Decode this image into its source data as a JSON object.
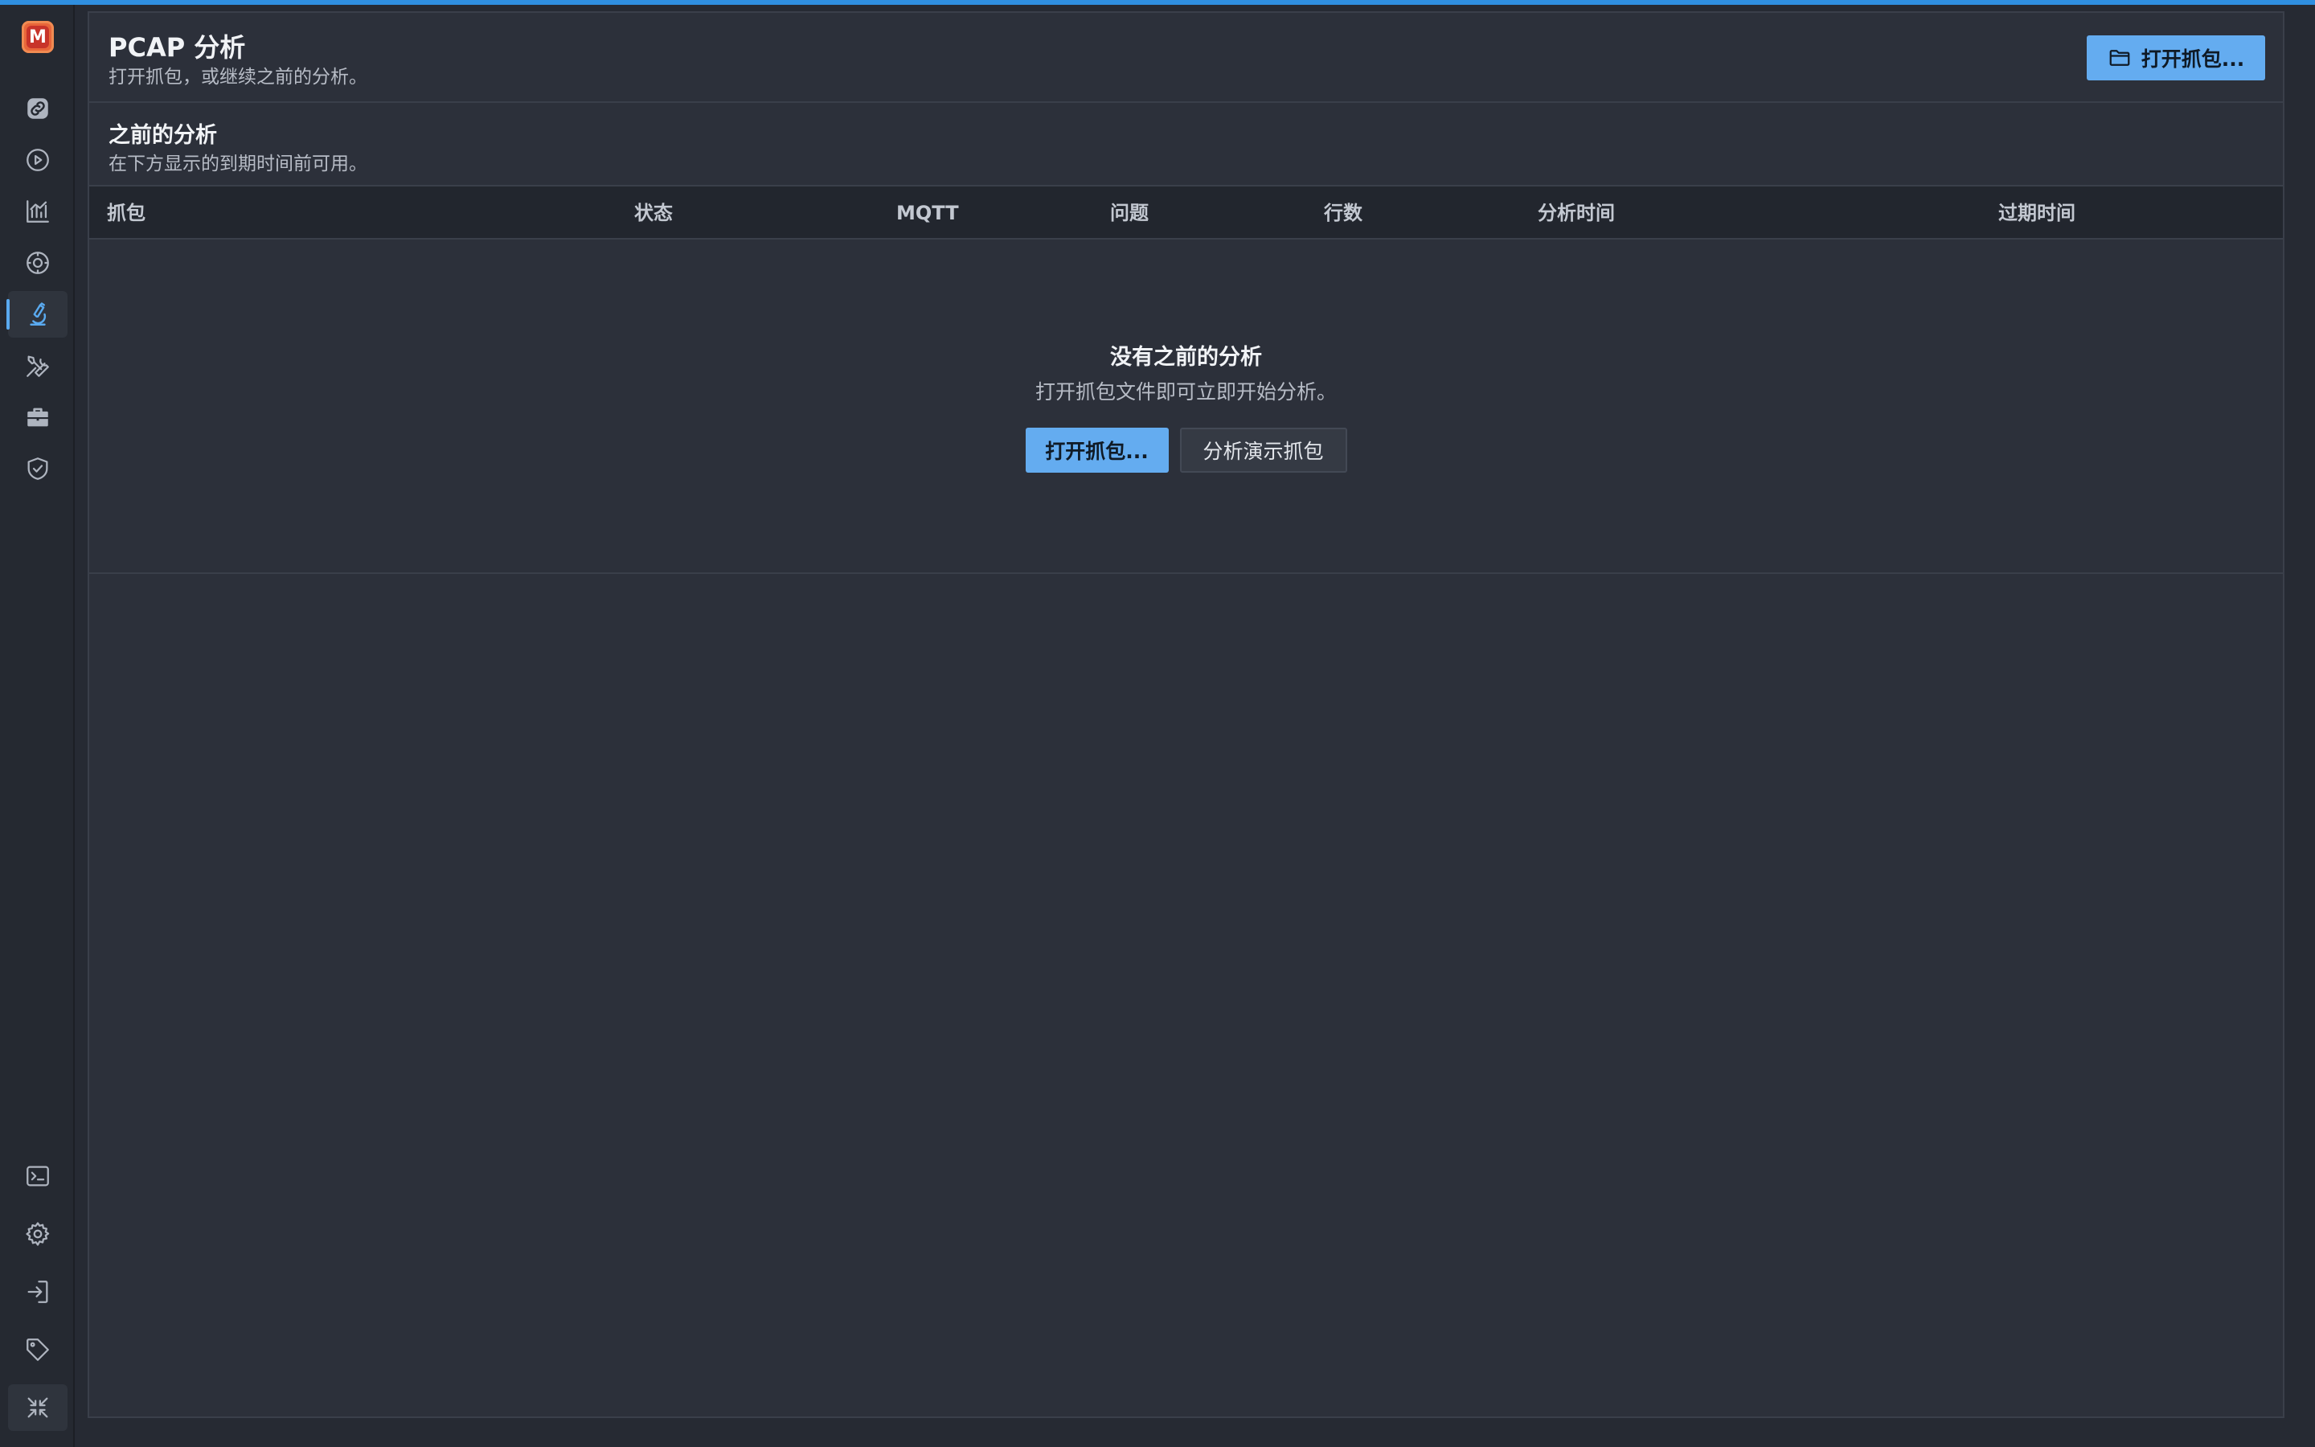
{
  "app": {
    "logo_letter": "M",
    "accent_color": "#64acf0"
  },
  "sidebar": {
    "top_items": [
      {
        "icon": "link-icon"
      },
      {
        "icon": "play-circle-icon"
      },
      {
        "icon": "chart-icon"
      },
      {
        "icon": "monitor-icon"
      },
      {
        "icon": "microscope-icon",
        "active": true
      },
      {
        "icon": "tools-icon"
      },
      {
        "icon": "toolbox-icon"
      },
      {
        "icon": "shield-check-icon"
      }
    ],
    "bottom_items": [
      {
        "icon": "terminal-icon"
      },
      {
        "icon": "gear-icon"
      },
      {
        "icon": "sign-in-icon"
      },
      {
        "icon": "tag-icon"
      },
      {
        "icon": "collapse-icon"
      }
    ]
  },
  "header": {
    "title": "PCAP 分析",
    "subtitle": "打开抓包，或继续之前的分析。",
    "open_button": "打开抓包..."
  },
  "previous": {
    "title": "之前的分析",
    "subtitle": "在下方显示的到期时间前可用。"
  },
  "table": {
    "columns": [
      "抓包",
      "状态",
      "MQTT",
      "问题",
      "行数",
      "分析时间",
      "过期时间"
    ]
  },
  "empty_state": {
    "title": "没有之前的分析",
    "subtitle": "打开抓包文件即可立即开始分析。",
    "open_button": "打开抓包...",
    "demo_button": "分析演示抓包"
  }
}
